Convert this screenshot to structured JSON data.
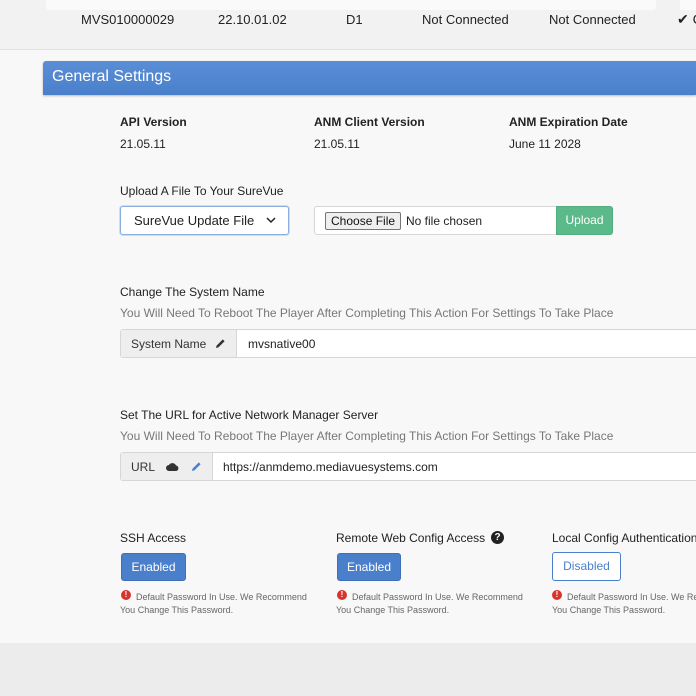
{
  "device_row": {
    "serial": "MVS010000029",
    "version": "22.10.01.02",
    "type": "D1",
    "status_1": "Not Connected",
    "status_2": "Not Connected",
    "check_text": "✔ C"
  },
  "panel": {
    "title": "General Settings"
  },
  "versions": {
    "api_label": "API Version",
    "api_value": "21.05.11",
    "client_label": "ANM Client Version",
    "client_value": "21.05.11",
    "expiration_label": "ANM Expiration Date",
    "expiration_value": "June 11 2028"
  },
  "upload": {
    "title": "Upload A File To Your SureVue",
    "selected_type": "SureVue Update File",
    "choose_file_label": "Choose File",
    "file_status": "No file chosen",
    "upload_label": "Upload"
  },
  "system_name": {
    "title": "Change The System Name",
    "note": "You Will Need To Reboot The Player After Completing This Action For Settings To Take Place",
    "addon_label": "System Name",
    "value": "mvsnative00"
  },
  "anm_url": {
    "title": "Set The URL for Active Network Manager Server",
    "note": "You Will Need To Reboot The Player After Completing This Action For Settings To Take Place",
    "addon_label": "URL",
    "value": "https://anmdemo.mediavuesystems.com"
  },
  "access": {
    "ssh_label": "SSH Access",
    "ssh_state": "Enabled",
    "remote_label": "Remote Web Config Access",
    "remote_state": "Enabled",
    "local_label": "Local Config Authentication",
    "local_state": "Disabled",
    "warning_line1": "Default Password In Use. We Recommend",
    "warning_line1_short": "Default Password In Use. We Re",
    "warning_line2": "You Change This Password."
  },
  "colors": {
    "primary": "#4a7fcb",
    "success": "#5cb98a",
    "danger": "#d9342b"
  }
}
